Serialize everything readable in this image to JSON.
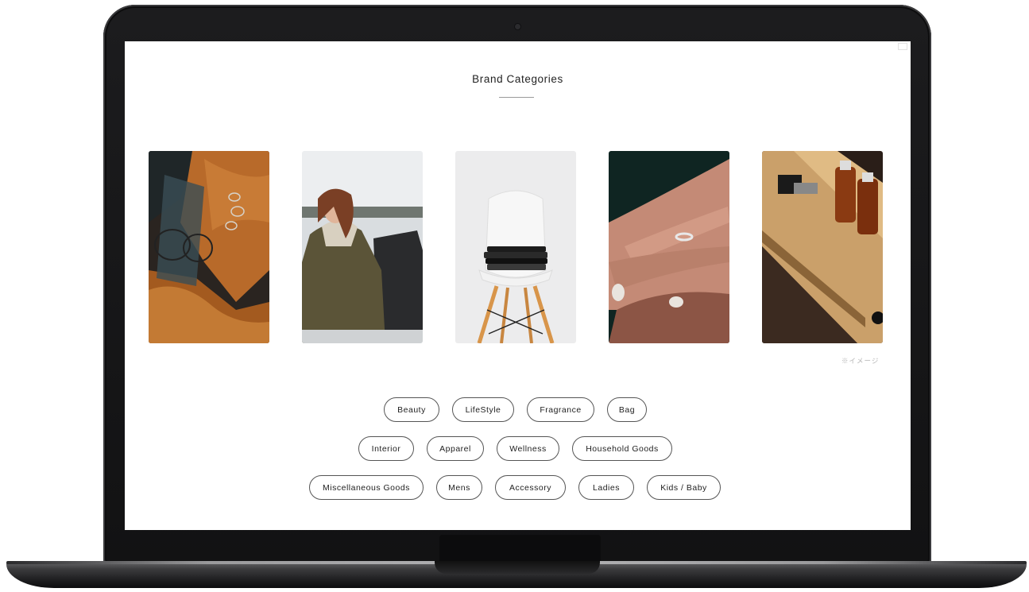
{
  "page": {
    "title": "Brand Categories",
    "image_note": "※イメージ"
  },
  "photos": [
    {
      "label": "photo-jewelry-glasses",
      "colors": [
        "#b86a2a",
        "#1f2a2e"
      ]
    },
    {
      "label": "photo-woman-backpack",
      "colors": [
        "#5b5438",
        "#e9ebee"
      ]
    },
    {
      "label": "photo-chair-clothes",
      "colors": [
        "#efefef",
        "#1b1b1b"
      ]
    },
    {
      "label": "photo-hands-ring",
      "colors": [
        "#0f2522",
        "#b07563"
      ]
    },
    {
      "label": "photo-amber-bottles",
      "colors": [
        "#c79860",
        "#6b2d0e"
      ]
    }
  ],
  "categories": {
    "row1": [
      "Beauty",
      "LifeStyle",
      "Fragrance",
      "Bag"
    ],
    "row2": [
      "Interior",
      "Apparel",
      "Wellness",
      "Household Goods"
    ],
    "row3": [
      "Miscellaneous Goods",
      "Mens",
      "Accessory",
      "Ladies",
      "Kids / Baby"
    ]
  },
  "colors": {
    "device_frame": "#151516",
    "screen_bg": "#ffffff",
    "pill_border": "#555555",
    "text": "#222222"
  }
}
